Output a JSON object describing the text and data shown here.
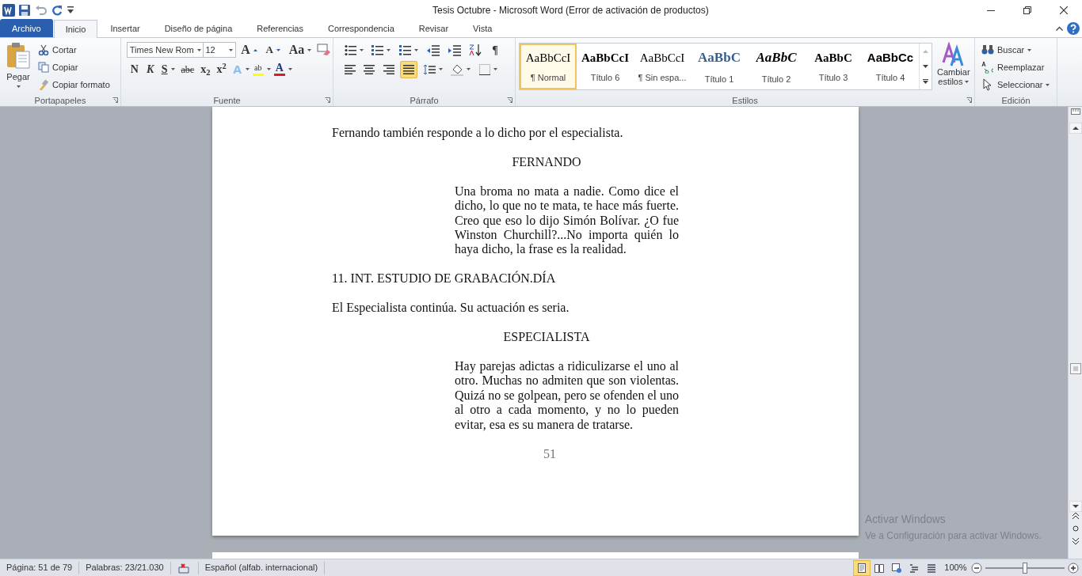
{
  "window": {
    "title": "Tesis Octubre  -  Microsoft Word (Error de activación de productos)"
  },
  "tabs": [
    {
      "label": "Archivo",
      "kind": "file",
      "selected": false
    },
    {
      "label": "Inicio",
      "kind": "tab",
      "selected": true
    },
    {
      "label": "Insertar",
      "kind": "tab",
      "selected": false
    },
    {
      "label": "Diseño de página",
      "kind": "tab",
      "selected": false
    },
    {
      "label": "Referencias",
      "kind": "tab",
      "selected": false
    },
    {
      "label": "Correspondencia",
      "kind": "tab",
      "selected": false
    },
    {
      "label": "Revisar",
      "kind": "tab",
      "selected": false
    },
    {
      "label": "Vista",
      "kind": "tab",
      "selected": false
    }
  ],
  "clipboard": {
    "paste": "Pegar",
    "items": [
      "Cortar",
      "Copiar",
      "Copiar formato"
    ],
    "label": "Portapapeles"
  },
  "font": {
    "name": "Times New Rom",
    "size": "12",
    "row1": [
      "A",
      "A",
      "Aa"
    ],
    "row2": [
      "N",
      "K",
      "S",
      "abc",
      "x$_{2}$",
      "x$^{2}$"
    ],
    "effects": [
      "A",
      "ab",
      "A"
    ],
    "label": "Fuente"
  },
  "paragraph": {
    "pilcrow": "¶",
    "alignment": [
      {
        "kind": "left",
        "selected": false
      },
      {
        "kind": "center",
        "selected": false
      },
      {
        "kind": "right",
        "selected": false
      },
      {
        "kind": "justify",
        "selected": true
      }
    ],
    "label": "Párrafo"
  },
  "styles": {
    "items": [
      {
        "sample": "AaBbCcI",
        "label": "¶ Normal",
        "kind": "normal",
        "selected": true
      },
      {
        "sample": "AaBbCcI",
        "label": "Título 6",
        "kind": "h6",
        "selected": false
      },
      {
        "sample": "AaBbCcI",
        "label": "¶ Sin espa...",
        "kind": "nospacing",
        "selected": false
      },
      {
        "sample": "AaBbC",
        "label": "Título 1",
        "kind": "h1",
        "selected": false
      },
      {
        "sample": "AaBbC",
        "label": "Título 2",
        "kind": "h2",
        "selected": false
      },
      {
        "sample": "AaBbC",
        "label": "Título 3",
        "kind": "h3",
        "selected": false
      },
      {
        "sample": "AaBbCc",
        "label": "Título 4",
        "kind": "h4",
        "selected": false
      }
    ],
    "change": [
      "Cambiar",
      "estilos"
    ],
    "label": "Estilos"
  },
  "editing": {
    "items": [
      "Buscar",
      "Reemplazar",
      "Seleccionar"
    ],
    "label": "Edición"
  },
  "document": {
    "blocks": [
      {
        "kind": "action",
        "text": "Fernando también responde a lo dicho por el especialista."
      },
      {
        "kind": "character",
        "text": "FERNANDO"
      },
      {
        "kind": "dialogue",
        "text": "Una broma no mata a nadie. Como dice el dicho, lo que no te mata, te hace más fuerte. Creo que eso lo dijo Simón Bolívar. ¿O fue Winston Churchill?...No importa quién lo haya dicho, la frase es la realidad."
      },
      {
        "kind": "heading",
        "text": "11. INT. ESTUDIO DE GRABACIÓN.DÍA"
      },
      {
        "kind": "action",
        "text": "El Especialista  continúa. Su actuación es seria."
      },
      {
        "kind": "character",
        "text": "ESPECIALISTA"
      },
      {
        "kind": "dialogue",
        "text": "Hay parejas adictas a ridiculizarse el uno al otro. Muchas no admiten que son violentas. Quizá no se golpean, pero se ofenden el uno al otro a cada momento, y no lo pueden evitar, esa es su manera  de tratarse."
      }
    ],
    "page_number": "51"
  },
  "activation": {
    "title": "Activar Windows",
    "hint": "Ve a Configuración para activar Windows."
  },
  "status_bar": {
    "page": "Página: 51 de 79",
    "words": "Palabras: 23/21.030",
    "language": "Español (alfab. internacional)",
    "views": [
      {
        "kind": "print",
        "selected": true
      },
      {
        "kind": "reading",
        "selected": false
      },
      {
        "kind": "web",
        "selected": false
      },
      {
        "kind": "outline",
        "selected": false
      },
      {
        "kind": "draft",
        "selected": false
      }
    ],
    "zoom": "100%",
    "zoom_level": {
      "level": 0.5
    }
  }
}
